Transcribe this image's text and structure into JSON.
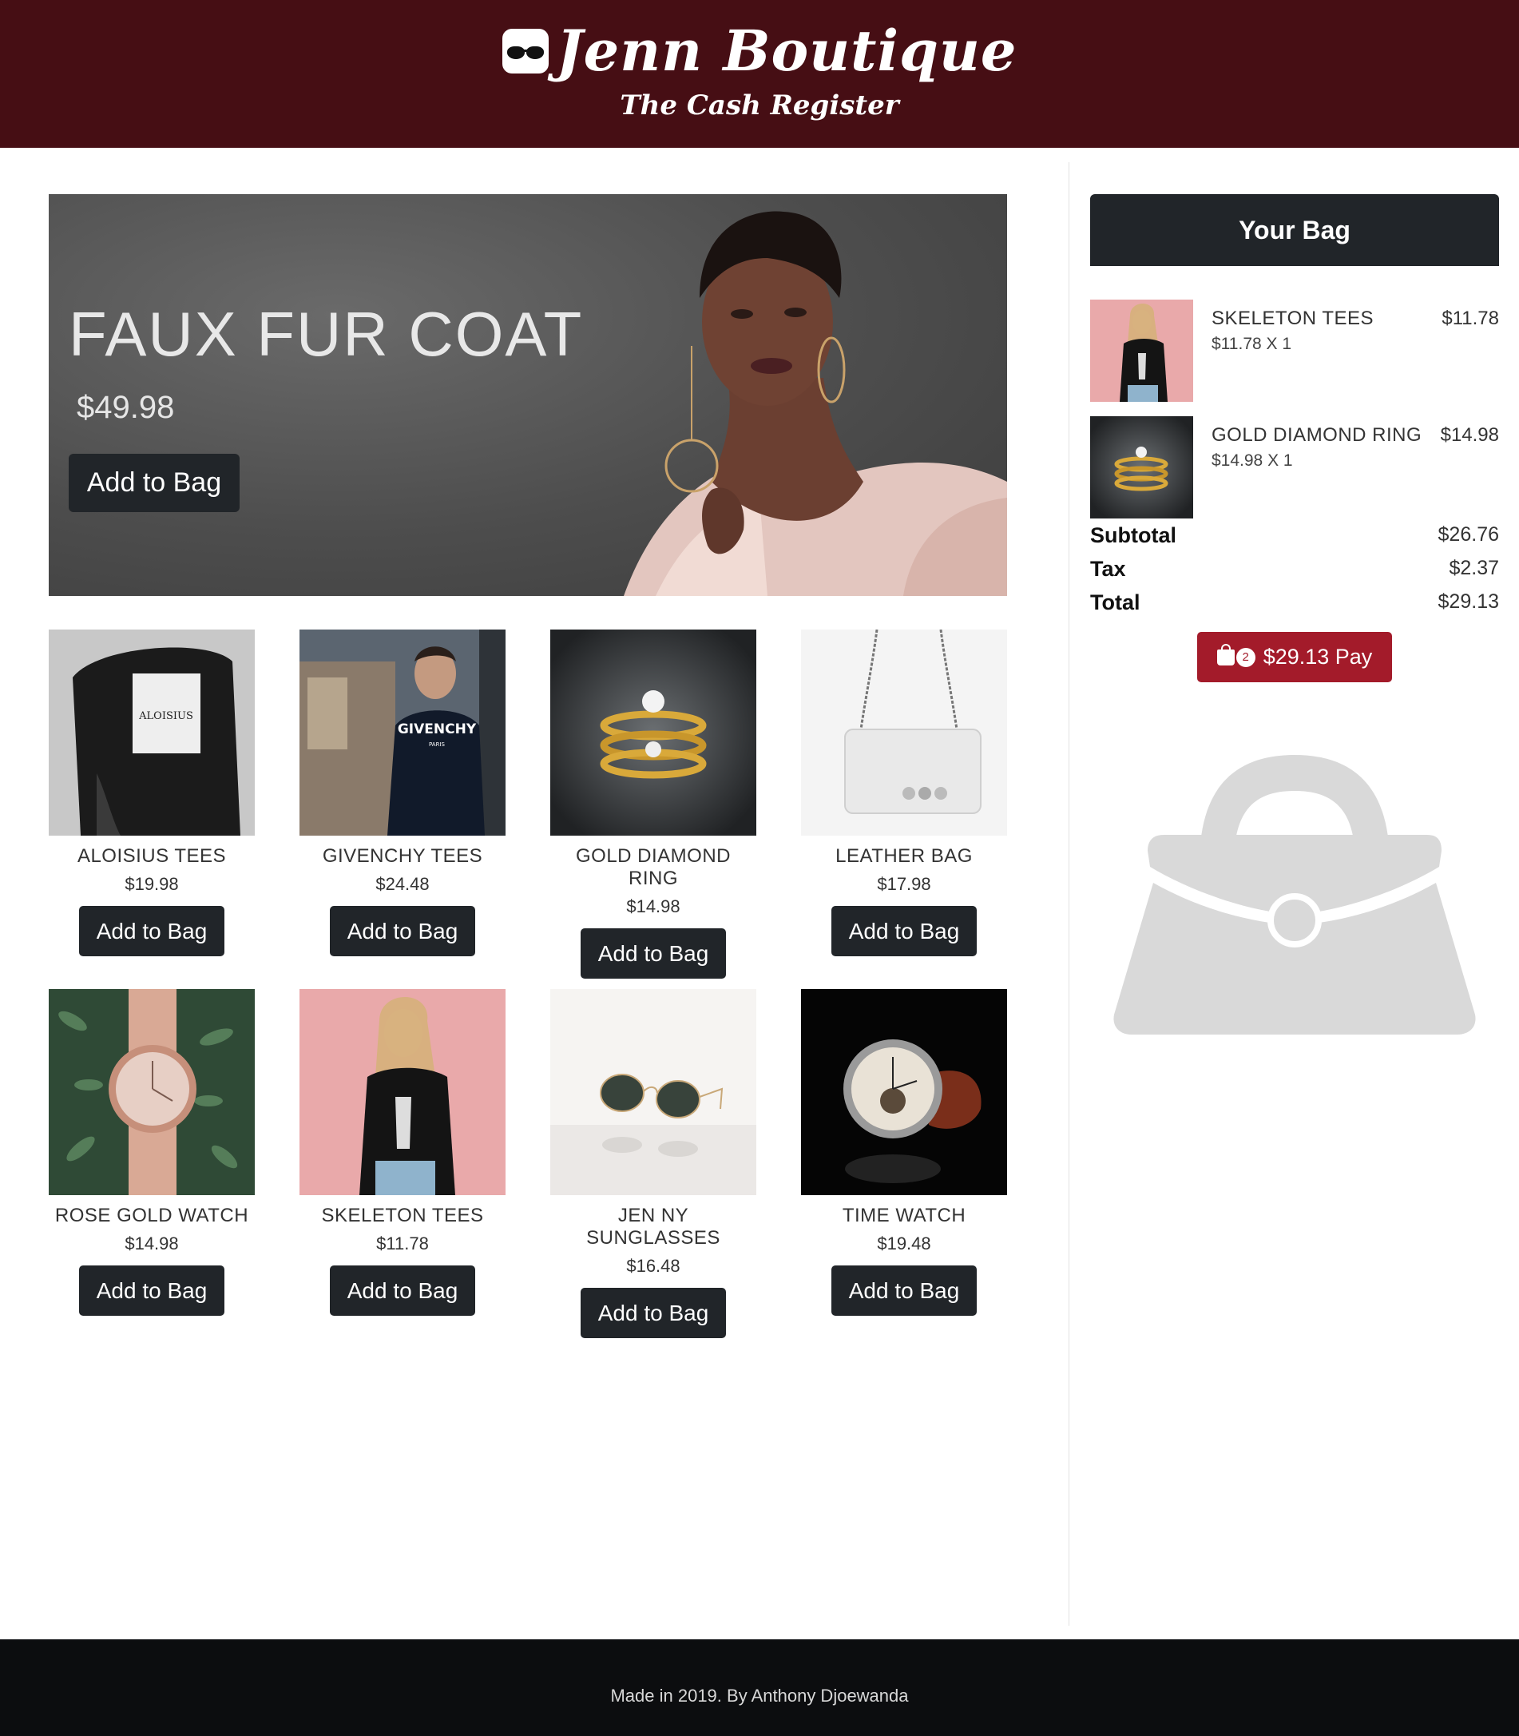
{
  "header": {
    "brand": "Jenn Boutique",
    "subtitle": "The Cash Register",
    "logo_icon": "glasses-face-icon",
    "background": "#460e14"
  },
  "hero": {
    "title": "FAUX FUR COAT",
    "price": "$49.98",
    "button_label": "Add to Bag"
  },
  "products": [
    {
      "name": "ALOISIUS TEES",
      "price": "$19.98",
      "button_label": "Add to Bag"
    },
    {
      "name": "GIVENCHY TEES",
      "price": "$24.48",
      "button_label": "Add to Bag"
    },
    {
      "name": "GOLD DIAMOND RING",
      "price": "$14.98",
      "button_label": "Add to Bag"
    },
    {
      "name": "LEATHER BAG",
      "price": "$17.98",
      "button_label": "Add to Bag"
    },
    {
      "name": "ROSE GOLD WATCH",
      "price": "$14.98",
      "button_label": "Add to Bag"
    },
    {
      "name": "SKELETON TEES",
      "price": "$11.78",
      "button_label": "Add to Bag"
    },
    {
      "name": "JEN NY SUNGLASSES",
      "price": "$16.48",
      "button_label": "Add to Bag"
    },
    {
      "name": "TIME WATCH",
      "price": "$19.48",
      "button_label": "Add to Bag"
    }
  ],
  "bag": {
    "title": "Your Bag",
    "items": [
      {
        "name": "SKELETON TEES",
        "qty_line": "$11.78 X 1",
        "line_total": "$11.78"
      },
      {
        "name": "GOLD DIAMOND RING",
        "qty_line": "$14.98 X 1",
        "line_total": "$14.98"
      }
    ],
    "summary": {
      "subtotal_label": "Subtotal",
      "subtotal": "$26.76",
      "tax_label": "Tax",
      "tax": "$2.37",
      "total_label": "Total",
      "total": "$29.13"
    },
    "pay": {
      "count": "2",
      "label": "$29.13 Pay",
      "icon": "shopping-bag-icon",
      "color": "#a31b2a"
    },
    "illustration_icon": "handbag-icon"
  },
  "footer": {
    "text": "Made in 2019. By Anthony Djoewanda"
  }
}
